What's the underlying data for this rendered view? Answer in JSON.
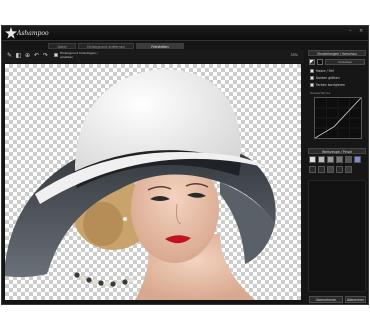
{
  "app": {
    "title": "Ashampoo"
  },
  "tabs": [
    {
      "label": "Datei"
    },
    {
      "label": "Hintergrund entfernen"
    },
    {
      "label": "Freistellen"
    }
  ],
  "toolbar": {
    "option_label": "Hintergrund hinzufügen / ersetzen",
    "zoom": "33%"
  },
  "panel": {
    "adjust_header": "Einstellungen / Vorschau",
    "preview_label": "Vorschau",
    "options": [
      {
        "label": "Haare / Fell",
        "checked": true
      },
      {
        "label": "Kanten glätten",
        "checked": true
      },
      {
        "label": "Farben korrigieren",
        "checked": true
      }
    ],
    "curve_label": "Tonwertkurve",
    "brush_header": "Werkzeuge / Pinsel",
    "apply_label": "Übernehmen",
    "cancel_label": "Abbrechen"
  },
  "colors": {
    "accent": "#3b3b3b",
    "background": "#151515",
    "checker": "#cccccc"
  }
}
